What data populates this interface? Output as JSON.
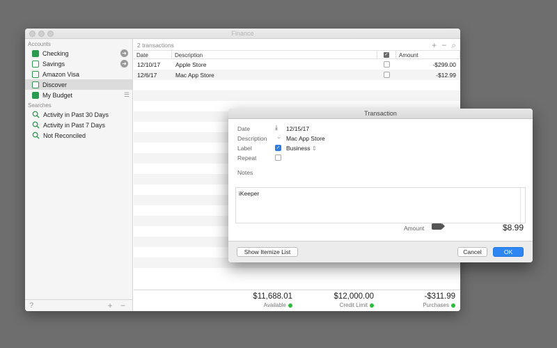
{
  "window": {
    "title": "Finance"
  },
  "sidebar": {
    "accounts_header": "Accounts",
    "accounts": [
      {
        "label": "Checking",
        "icon": "checkbook-icon"
      },
      {
        "label": "Savings",
        "icon": "savings-icon"
      },
      {
        "label": "Amazon Visa",
        "icon": "card-icon"
      },
      {
        "label": "Discover",
        "icon": "card-icon"
      },
      {
        "label": "My Budget",
        "icon": "budget-icon"
      }
    ],
    "searches_header": "Searches",
    "searches": [
      {
        "label": "Activity in Past 30 Days"
      },
      {
        "label": "Activity in Past 7 Days"
      },
      {
        "label": "Not Reconciled"
      }
    ],
    "footer": {
      "help": "?",
      "add_remove": "+ −"
    }
  },
  "table": {
    "count_label": "2 transactions",
    "toolbar_icons": [
      "+",
      "−",
      "⌕"
    ],
    "columns": [
      "Date",
      "Description",
      "",
      "Amount"
    ],
    "rows": [
      {
        "date": "12/10/17",
        "description": "Apple Store",
        "amount": "-$299.00"
      },
      {
        "date": "12/6/17",
        "description": "Mac App Store",
        "amount": "-$12.99"
      }
    ]
  },
  "summary": [
    {
      "value": "$11,688.01",
      "label": "Available"
    },
    {
      "value": "$12,000.00",
      "label": "Credit Limit"
    },
    {
      "value": "-$311.99",
      "label": "Purchases"
    }
  ],
  "transaction": {
    "title": "Transaction",
    "date_label": "Date",
    "date": "12/15/17",
    "description_label": "Description",
    "description": "Mac App Store",
    "label_label": "Label",
    "label_value": "Business",
    "repeat_label": "Repeat",
    "notes_label": "Notes",
    "notes": "iKeeper",
    "amount_label": "Amount",
    "amount": "$8.99",
    "itemize_button": "Show Itemize List",
    "cancel_button": "Cancel",
    "ok_button": "OK"
  },
  "colors": {
    "accent": "#2d86f2",
    "account_green": "#2a9a4f",
    "status_green": "#2bbd3a"
  }
}
